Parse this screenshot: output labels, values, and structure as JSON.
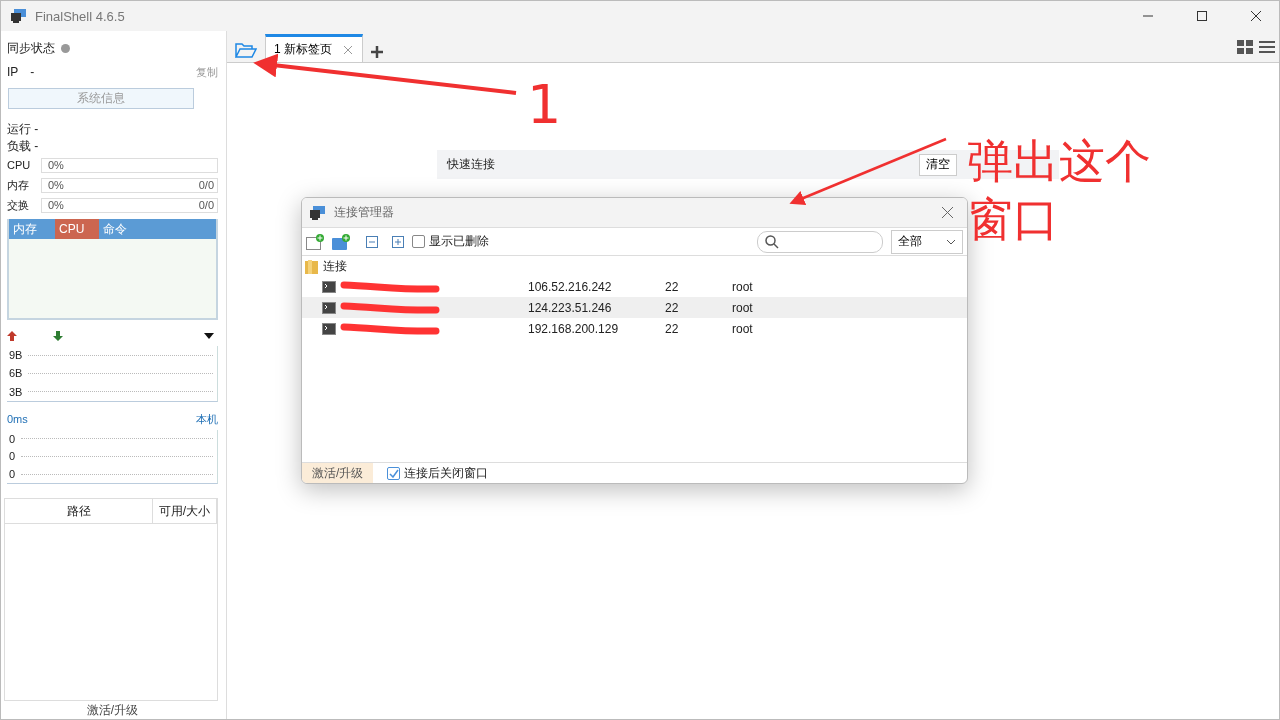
{
  "window": {
    "title": "FinalShell 4.6.5"
  },
  "sidebar": {
    "sync_status": {
      "label": "同步状态",
      "online": false
    },
    "ip": {
      "label": "IP",
      "value": "-",
      "copy": "复制"
    },
    "sysinfo_button": "系统信息",
    "uptime": "运行 -",
    "load": "负载 -",
    "meters": [
      {
        "label": "CPU",
        "reading": "0%"
      },
      {
        "label": "内存",
        "reading": "0%",
        "total": "0/0"
      },
      {
        "label": "交换",
        "reading": "0%",
        "total": "0/0"
      }
    ],
    "process_tabs": [
      {
        "label": "内存",
        "selected": false
      },
      {
        "label": "CPU",
        "selected": true
      },
      {
        "label": "命令",
        "selected": false
      }
    ],
    "net_chart": {
      "y_labels": [
        "9B",
        "6B",
        "3B"
      ]
    },
    "ping": {
      "value": "0ms",
      "target": "本机",
      "y_labels": [
        "0",
        "0",
        "0"
      ]
    },
    "disk_table": {
      "columns": [
        "路径",
        "可用/大小"
      ]
    },
    "footer": "激活/升级"
  },
  "tabs": [
    {
      "label": "1 新标签页",
      "selected": true
    }
  ],
  "quick_connect": {
    "label": "快速连接",
    "button": "清空"
  },
  "dialog": {
    "title": "连接管理器",
    "show_deleted": {
      "label": "显示已删除",
      "checked": false
    },
    "filter": "全部",
    "folder": {
      "name": "连接"
    },
    "rows": [
      {
        "host": "106.52.216.242",
        "port": "22",
        "user": "root",
        "selected": false
      },
      {
        "host": "124.223.51.246",
        "port": "22",
        "user": "root",
        "selected": true
      },
      {
        "host": "192.168.200.129",
        "port": "22",
        "user": "root",
        "selected": false
      }
    ],
    "footer": {
      "activate": "激活/升级",
      "close_after": {
        "label": "连接后关闭窗口",
        "checked": true
      }
    }
  },
  "annotations": [
    {
      "text": "1"
    },
    {
      "text": "弹出这个窗口"
    }
  ]
}
